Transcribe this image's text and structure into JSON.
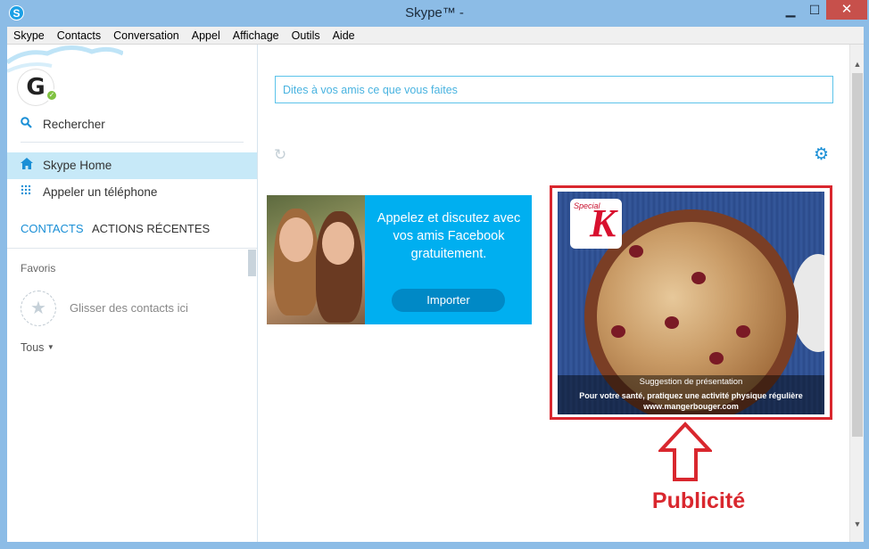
{
  "window": {
    "title": "Skype™ -",
    "app_icon": "S",
    "minimize_label": "▁",
    "maximize_label": "☐",
    "close_label": "✕"
  },
  "menubar": {
    "items": [
      "Skype",
      "Contacts",
      "Conversation",
      "Appel",
      "Affichage",
      "Outils",
      "Aide"
    ]
  },
  "profile": {
    "avatar_text": "G",
    "presence": "online"
  },
  "sidebar": {
    "search_label": "Rechercher",
    "home_label": "Skype Home",
    "call_phone_label": "Appeler un téléphone",
    "tabs": {
      "contacts": "CONTACTS",
      "recent": "ACTIONS RÉCENTES"
    },
    "favorites_label": "Favoris",
    "drop_contacts_label": "Glisser des contacts ici",
    "all_label": "Tous"
  },
  "main": {
    "mood_placeholder": "Dites à vos amis ce que vous faites",
    "promo": {
      "text": "Appelez et discutez avec vos amis Facebook gratuitement.",
      "button_label": "Importer"
    },
    "ad": {
      "brand_special": "Special",
      "brand_k": "K",
      "suggestion": "Suggestion de présentation",
      "health_line": "Pour votre santé, pratiquez une activité physique régulière",
      "website": "www.mangerbouger.com"
    },
    "annotation_label": "Publicité"
  },
  "colors": {
    "accent": "#1a8fd6",
    "promo_bg": "#00aff0",
    "annotation_red": "#d9272e",
    "selected_row": "#c7e9f8"
  }
}
